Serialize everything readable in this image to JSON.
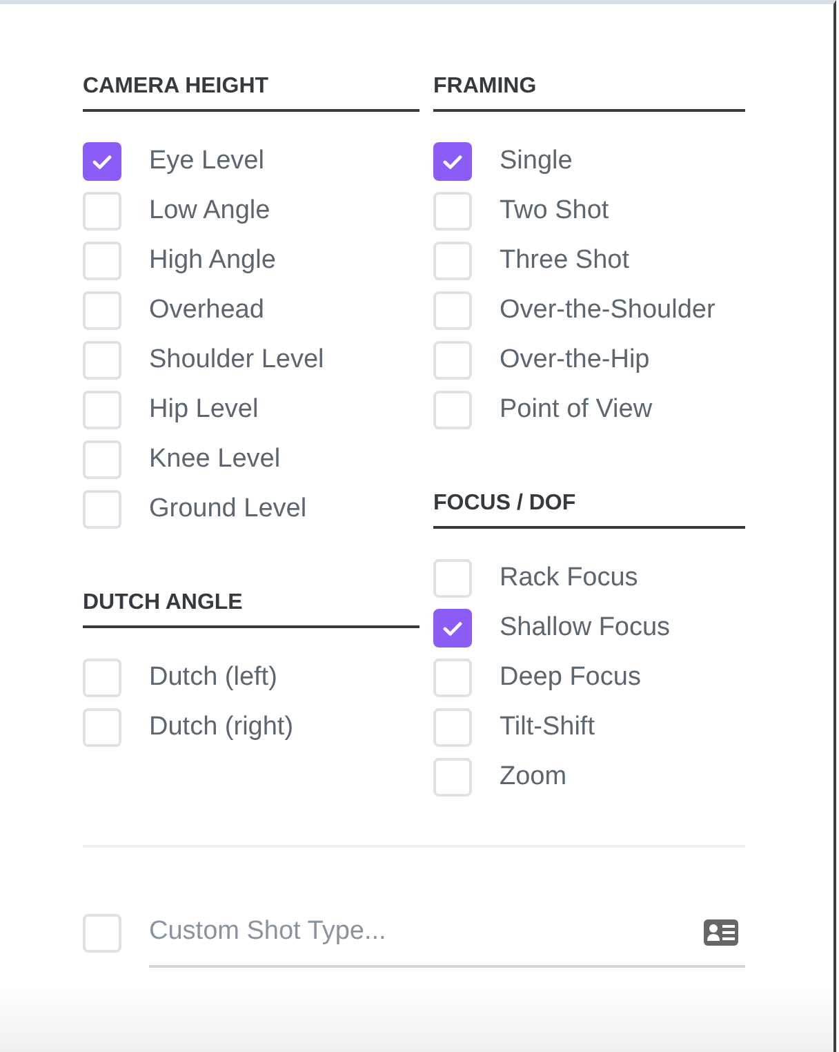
{
  "columns": [
    {
      "sections": [
        {
          "title": "CAMERA HEIGHT",
          "options": [
            {
              "label": "Eye Level",
              "checked": true
            },
            {
              "label": "Low Angle",
              "checked": false
            },
            {
              "label": "High Angle",
              "checked": false
            },
            {
              "label": "Overhead",
              "checked": false
            },
            {
              "label": "Shoulder Level",
              "checked": false
            },
            {
              "label": "Hip Level",
              "checked": false
            },
            {
              "label": "Knee Level",
              "checked": false
            },
            {
              "label": "Ground Level",
              "checked": false
            }
          ]
        },
        {
          "title": "DUTCH ANGLE",
          "options": [
            {
              "label": "Dutch (left)",
              "checked": false
            },
            {
              "label": "Dutch (right)",
              "checked": false
            }
          ]
        }
      ]
    },
    {
      "sections": [
        {
          "title": "FRAMING",
          "options": [
            {
              "label": "Single",
              "checked": true
            },
            {
              "label": "Two Shot",
              "checked": false
            },
            {
              "label": "Three Shot",
              "checked": false
            },
            {
              "label": "Over-the-Shoulder",
              "checked": false
            },
            {
              "label": "Over-the-Hip",
              "checked": false
            },
            {
              "label": "Point of View",
              "checked": false
            }
          ]
        },
        {
          "title": "FOCUS / DOF",
          "options": [
            {
              "label": "Rack Focus",
              "checked": false
            },
            {
              "label": "Shallow Focus",
              "checked": true
            },
            {
              "label": "Deep Focus",
              "checked": false
            },
            {
              "label": "Tilt-Shift",
              "checked": false
            },
            {
              "label": "Zoom",
              "checked": false
            }
          ]
        }
      ]
    }
  ],
  "custom_shot": {
    "checked": false,
    "placeholder": "Custom Shot Type..."
  }
}
